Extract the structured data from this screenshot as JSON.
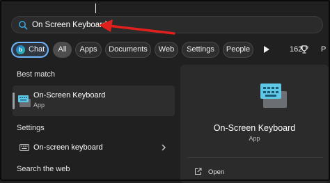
{
  "search": {
    "query": "On Screen Keyboard"
  },
  "filters": {
    "chat": "Chat",
    "all": "All",
    "apps": "Apps",
    "documents": "Documents",
    "web": "Web",
    "settings": "Settings",
    "people": "People",
    "count": "162",
    "more": "P"
  },
  "results": {
    "best_match_heading": "Best match",
    "best_match": {
      "title": "On-Screen Keyboard",
      "subtitle": "App"
    },
    "settings_heading": "Settings",
    "settings_item": "On-screen keyboard",
    "web_heading": "Search the web"
  },
  "detail": {
    "title": "On-Screen Keyboard",
    "subtitle": "App",
    "action_open": "Open"
  },
  "colors": {
    "background": "#202020",
    "panel": "#2b2b2b",
    "accent_chat_border": "#6fb6ff",
    "annotation_arrow": "#e0201c"
  },
  "icons": [
    "search-icon",
    "bing-icon",
    "play-icon",
    "trophy-icon",
    "keyboard-app-icon",
    "keyboard-icon",
    "chevron-right-icon",
    "open-icon"
  ]
}
